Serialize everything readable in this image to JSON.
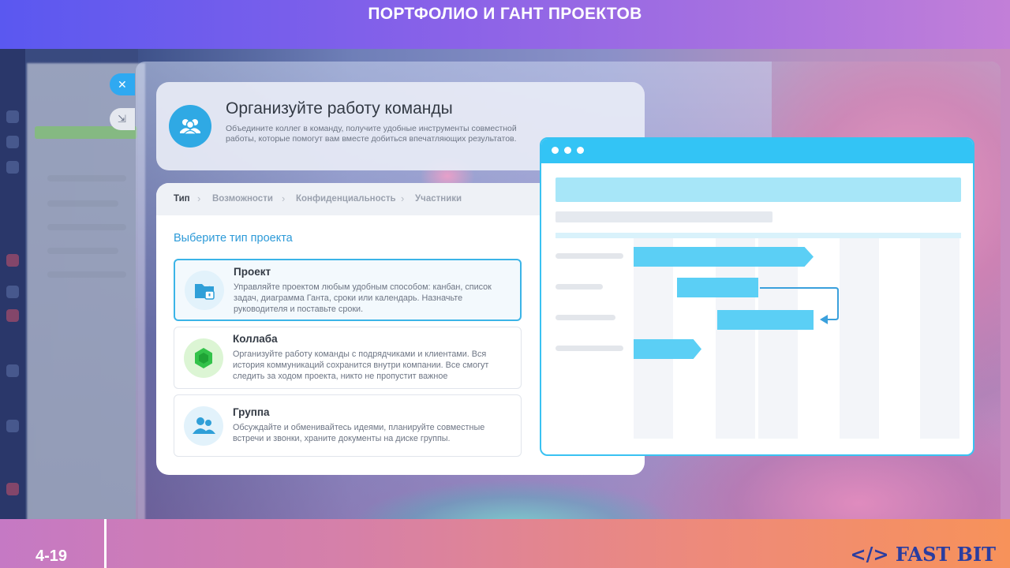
{
  "banner": {
    "title": "ПОРТФОЛИО И ГАНТ ПРОЕКТОВ"
  },
  "window_controls": {
    "close_icon": "close-icon",
    "collapse_icon": "collapse-arrow-icon"
  },
  "header": {
    "icon": "team-icon",
    "title": "Организуйте работу команды",
    "description": "Объедините коллег в команду, получите удобные инструменты совместной работы, которые помогут вам вместе добиться впечатляющих результатов."
  },
  "wizard": {
    "steps": [
      {
        "label": "Тип",
        "active": true
      },
      {
        "label": "Возможности",
        "active": false
      },
      {
        "label": "Конфиденциальность",
        "active": false
      },
      {
        "label": "Участники",
        "active": false
      }
    ],
    "choose_title": "Выберите тип проекта",
    "options": [
      {
        "title": "Проект",
        "icon": "folder-lock-icon",
        "selected": true,
        "description": "Управляйте проектом любым удобным способом: канбан, список задач, диаграмма Ганта, сроки или календарь. Назначьте руководителя и поставьте сроки."
      },
      {
        "title": "Коллаба",
        "icon": "hexagon-icon",
        "selected": false,
        "description": "Организуйте работу команды с подрядчиками и клиентами. Вся история коммуникаций сохранится внутри компании. Все смогут следить за ходом проекта, никто не пропустит важное"
      },
      {
        "title": "Группа",
        "icon": "group-icon",
        "selected": false,
        "description": "Обсуждайте и обменивайтесь идеями, планируйте совместные встречи и звонки, храните документы на диске группы."
      }
    ]
  },
  "colors": {
    "accent": "#2fa9e4",
    "selected_border": "#3bb4e7",
    "collab_green": "#33c24a",
    "gantt_task": "#5bcff5"
  },
  "footer": {
    "slide_number": "4-19",
    "logo": "</> FAST BIT"
  }
}
